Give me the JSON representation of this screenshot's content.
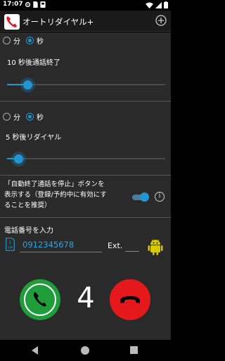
{
  "status_bar": {
    "time": "17:07",
    "left_icons": [
      "gear-icon",
      "sim-icon",
      "card-icon"
    ],
    "right_icons": [
      "wifi-icon",
      "signal-icon",
      "battery-icon"
    ]
  },
  "app_bar": {
    "title": "オートリダイヤル+",
    "icon": "phone-logo-icon",
    "action_icon": "add-circle-icon"
  },
  "call_duration": {
    "unit_options": [
      "分",
      "秒"
    ],
    "selected_unit": "秒",
    "label": "10 秒後通話終了",
    "slider_fraction": 0.13
  },
  "redial_delay": {
    "unit_options": [
      "分",
      "秒"
    ],
    "selected_unit": "秒",
    "label": "5 秒後リダイヤル",
    "slider_fraction": 0.07
  },
  "auto_end_notice": {
    "text_lines": [
      "「自動終了通話を停止」ボタンを",
      "表示する（登録/予約中に有効にす",
      "ることを推奨）"
    ],
    "toggle_on": true,
    "info_icon": "info-icon"
  },
  "phone_entry": {
    "label": "電話番号を入力",
    "sim_label": "1\nSIM",
    "number": "0912345678",
    "ext_label": "Ext.",
    "ext_value": ""
  },
  "controls": {
    "counter": "4",
    "call_color": "#1f9d3a",
    "hangup_color": "#e5191c"
  },
  "colors": {
    "accent": "#2196d3",
    "background": "#2a2a2a",
    "android": "#d8c800"
  }
}
